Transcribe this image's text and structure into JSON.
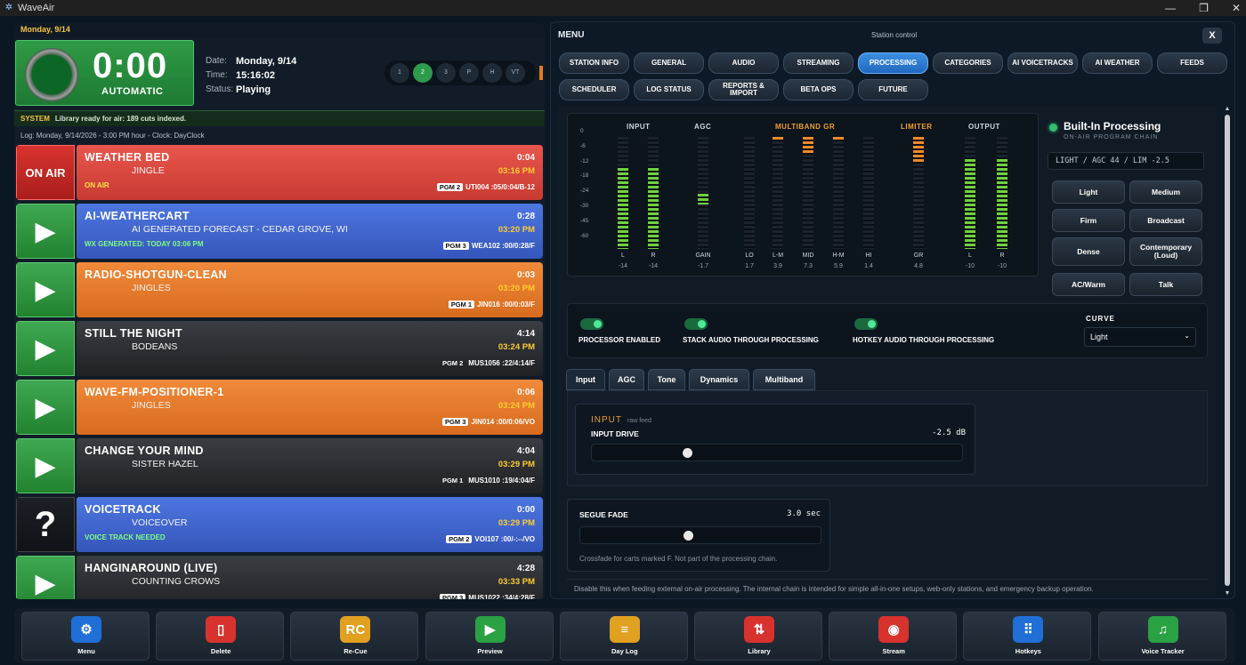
{
  "window": {
    "title": "WaveAir",
    "minimize": "—",
    "maximize": "❐",
    "close": "✕"
  },
  "left": {
    "date_strip": "Monday, 9/14",
    "clock": {
      "time": "0:00",
      "mode": "AUTOMATIC"
    },
    "info": {
      "date_label": "Date:",
      "date": "Monday, 9/14",
      "time_label": "Time:",
      "time": "15:16:02",
      "status_label": "Status:",
      "status": "Playing"
    },
    "pager": [
      "1",
      "2",
      "3",
      "P",
      "H",
      "VT"
    ],
    "system": {
      "tag": "SYSTEM",
      "message": "Library ready for air: 189 cuts indexed."
    },
    "log_line": "Log: Monday, 9/14/2026 - 3:00 PM hour - Clock: DayClock",
    "carts": [
      {
        "button": "ON AIR",
        "title": "WEATHER BED",
        "artist": "JINGLE",
        "duration": "0:04",
        "time": "03:16 PM",
        "status": "ON AIR",
        "pgm": "PGM 2",
        "code": "UTI004 :05/0:04/B-12"
      },
      {
        "button": "▶",
        "title": "AI-WEATHERCART",
        "artist": "AI GENERATED FORECAST - CEDAR GROVE, WI",
        "duration": "0:28",
        "time": "03:20 PM",
        "status": "WX GENERATED: TODAY 03:06 PM",
        "pgm": "PGM 3",
        "code": "WEA102 :00/0:28/F"
      },
      {
        "button": "▶",
        "title": "RADIO-SHOTGUN-CLEAN",
        "artist": "JINGLES",
        "duration": "0:03",
        "time": "03:20 PM",
        "status": "",
        "pgm": "PGM 1",
        "code": "JIN016 :00/0:03/F"
      },
      {
        "button": "▶",
        "title": "STILL THE NIGHT",
        "artist": "BODEANS",
        "duration": "4:14",
        "time": "03:24 PM",
        "status": "",
        "pgm": "PGM 2",
        "code": "MUS1056 :22/4:14/F"
      },
      {
        "button": "▶",
        "title": "WAVE-FM-POSITIONER-1",
        "artist": "JINGLES",
        "duration": "0:06",
        "time": "03:24 PM",
        "status": "",
        "pgm": "PGM 3",
        "code": "JIN014 :00/0:06/VO"
      },
      {
        "button": "▶",
        "title": "CHANGE YOUR MIND",
        "artist": "SISTER HAZEL",
        "duration": "4:04",
        "time": "03:29 PM",
        "status": "",
        "pgm": "PGM 1",
        "code": "MUS1010 :19/4:04/F"
      },
      {
        "button": "?",
        "title": "VOICETRACK",
        "artist": "VOICEOVER",
        "duration": "0:00",
        "time": "03:29 PM",
        "status": "VOICE TRACK NEEDED",
        "pgm": "PGM 2",
        "code": "VOI107 :00/-:--/VO"
      },
      {
        "button": "▶",
        "title": "HANGINAROUND (LIVE)",
        "artist": "COUNTING CROWS",
        "duration": "4:28",
        "time": "03:33 PM",
        "status": "",
        "pgm": "PGM 3",
        "code": "MUS1022 :34/4:28/F"
      }
    ]
  },
  "right": {
    "menu_title": "MENU",
    "subtitle": "Station control",
    "close_label": "X",
    "tabs": [
      "STATION INFO",
      "GENERAL",
      "AUDIO",
      "STREAMING",
      "PROCESSING",
      "CATEGORIES",
      "AI VOICETRACKS",
      "AI WEATHER",
      "FEEDS",
      "SCHEDULER",
      "LOG STATUS",
      "REPORTS & IMPORT",
      "BETA OPS",
      "FUTURE"
    ],
    "active_tab": "PROCESSING",
    "meters": {
      "labels": {
        "input": "INPUT",
        "agc": "AGC",
        "multiband": "MULTIBAND GR",
        "limiter": "LIMITER",
        "output": "OUTPUT"
      },
      "scale": [
        "0",
        "-6",
        "-12",
        "-18",
        "-24",
        "-30",
        "-45",
        "-60"
      ],
      "channels": [
        {
          "name": "L",
          "value": "-14",
          "level": 0.72
        },
        {
          "name": "R",
          "value": "-14",
          "level": 0.72
        },
        {
          "name": "GAIN",
          "value": "-1.7",
          "level": 0.1
        },
        {
          "name": "LO",
          "value": "1.7",
          "level": 0.0
        },
        {
          "name": "L-M",
          "value": "3.9",
          "level": 0.02
        },
        {
          "name": "MID",
          "value": "7.3",
          "level": 0.16
        },
        {
          "name": "H-M",
          "value": "5.9",
          "level": 0.03
        },
        {
          "name": "HI",
          "value": "1.4",
          "level": 0.0
        },
        {
          "name": "GR",
          "value": "4.8",
          "level": 0.22
        },
        {
          "name": "L",
          "value": "-10",
          "level": 0.8
        },
        {
          "name": "R",
          "value": "-10",
          "level": 0.8
        }
      ]
    },
    "builtin": {
      "title": "Built-In Processing",
      "subtitle": "ON-AIR PROGRAM CHAIN",
      "chain": "LIGHT / AGC 44 / LIM -2.5"
    },
    "presets": [
      "Light",
      "Medium",
      "Firm",
      "Broadcast",
      "Dense",
      "Contemporary (Loud)",
      "AC/Warm",
      "Talk"
    ],
    "toggles": [
      {
        "label": "PROCESSOR ENABLED",
        "on": true
      },
      {
        "label": "STACK AUDIO THROUGH PROCESSING",
        "on": true
      },
      {
        "label": "HOTKEY AUDIO THROUGH PROCESSING",
        "on": true
      }
    ],
    "curve": {
      "label": "CURVE",
      "value": "Light"
    },
    "subtabs": [
      "Input",
      "AGC",
      "Tone",
      "Dynamics",
      "Multiband"
    ],
    "active_subtab": "Input",
    "input": {
      "heading": "INPUT",
      "hint": "raw feed",
      "drive_label": "INPUT DRIVE",
      "drive_value": "-2.5 dB",
      "drive_level": 0.25
    },
    "segue": {
      "label": "SEGUE FADE",
      "value": "3.0 sec",
      "level": 0.45,
      "note": "Crossfade for carts marked F. Not part of the processing chain."
    },
    "disclaimer": "Disable this when feeding external on-air processing. The internal chain is intended for simple all-in-one setups, web-only stations, and emergency backup operation."
  },
  "toolbar": [
    {
      "label": "Menu",
      "icon": "gear-icon",
      "color": "#1f6fd6",
      "glyph": "⚙"
    },
    {
      "label": "Delete",
      "icon": "trash-icon",
      "color": "#d8322e",
      "glyph": "▯"
    },
    {
      "label": "Re-Cue",
      "icon": "recue-icon",
      "color": "#e0a020",
      "glyph": "RC"
    },
    {
      "label": "Preview",
      "icon": "play-icon",
      "color": "#2aa143",
      "glyph": "▶"
    },
    {
      "label": "Day Log",
      "icon": "document-icon",
      "color": "#e0a020",
      "glyph": "≡"
    },
    {
      "label": "Library",
      "icon": "sort-icon",
      "color": "#d8322e",
      "glyph": "⇅"
    },
    {
      "label": "Stream",
      "icon": "target-icon",
      "color": "#d8322e",
      "glyph": "◉"
    },
    {
      "label": "Hotkeys",
      "icon": "grid-icon",
      "color": "#1f6fd6",
      "glyph": "⠿"
    },
    {
      "label": "Voice Tracker",
      "icon": "music-note-icon",
      "color": "#2aa143",
      "glyph": "♫"
    }
  ]
}
